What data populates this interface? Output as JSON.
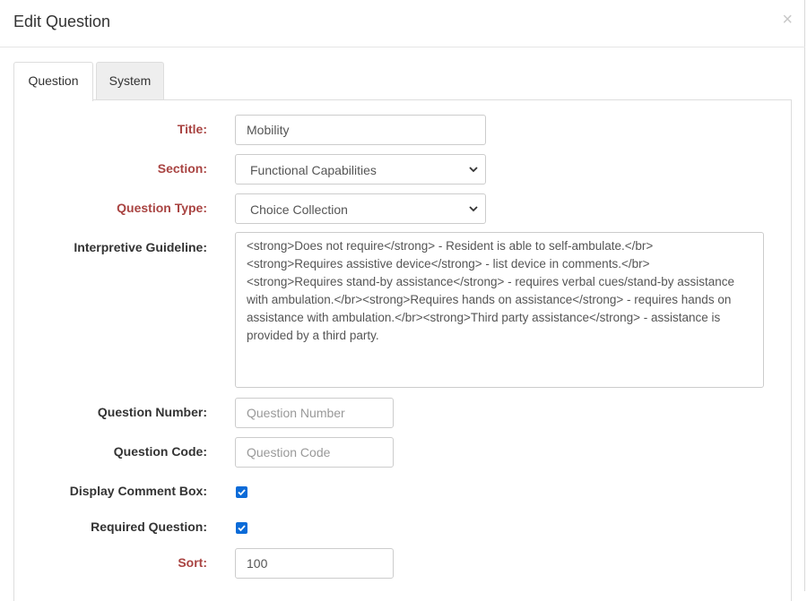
{
  "modal": {
    "title": "Edit Question",
    "close_label": "×"
  },
  "tabs": [
    {
      "label": "Question",
      "active": true
    },
    {
      "label": "System",
      "active": false
    }
  ],
  "form": {
    "title": {
      "label": "Title:",
      "value": "Mobility",
      "required": true
    },
    "section": {
      "label": "Section:",
      "value": "Functional Capabilities",
      "required": true
    },
    "question_type": {
      "label": "Question Type:",
      "value": "Choice Collection",
      "required": true
    },
    "interpretive_guideline": {
      "label": "Interpretive Guideline:",
      "value": "<strong>Does not require</strong> - Resident is able to self-ambulate.</br>\n<strong>Requires assistive device</strong> - list device in comments.</br>\n<strong>Requires stand-by assistance</strong> - requires verbal cues/stand-by assistance with ambulation.</br><strong>Requires hands on assistance</strong> - requires hands on assistance with ambulation.</br><strong>Third party assistance</strong> - assistance is provided by a third party."
    },
    "question_number": {
      "label": "Question Number:",
      "value": "",
      "placeholder": "Question Number"
    },
    "question_code": {
      "label": "Question Code:",
      "value": "",
      "placeholder": "Question Code"
    },
    "display_comment_box": {
      "label": "Display Comment Box:",
      "checked": true
    },
    "required_question": {
      "label": "Required Question:",
      "checked": true
    },
    "sort": {
      "label": "Sort:",
      "value": "100",
      "required": true
    }
  },
  "colors": {
    "required_label": "#a94442",
    "checkbox": "#0b6bd8"
  }
}
